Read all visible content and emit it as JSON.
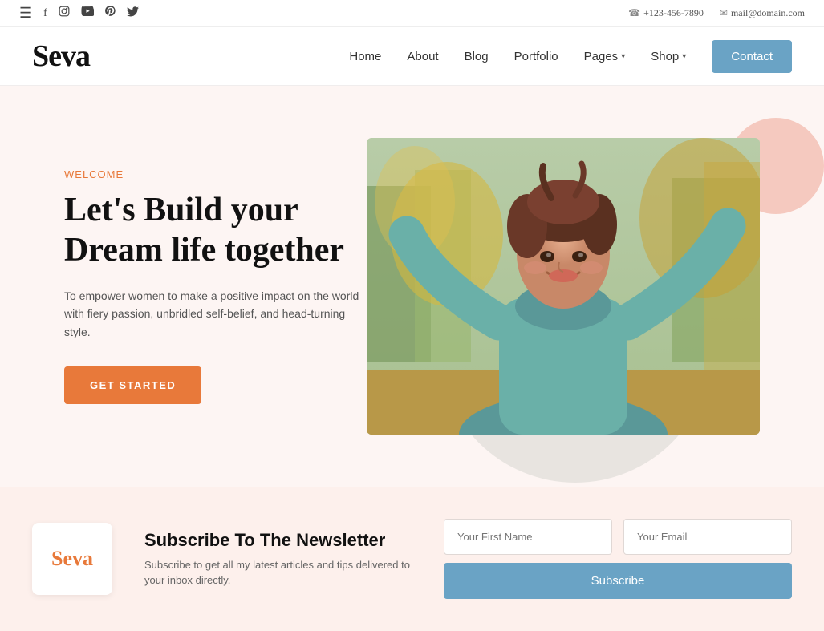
{
  "topbar": {
    "phone": "+123-456-7890",
    "email": "mail@domain.com",
    "phone_icon": "☎",
    "email_icon": "✉"
  },
  "header": {
    "logo": "Seva",
    "nav": {
      "home": "Home",
      "about": "About",
      "blog": "Blog",
      "portfolio": "Portfolio",
      "pages": "Pages",
      "shop": "Shop",
      "contact": "Contact"
    }
  },
  "hero": {
    "welcome_label": "Welcome",
    "title_line1": "Let's Build your",
    "title_line2": "Dream life together",
    "description": "To empower women to make a positive impact on the world with fiery passion, unbridled self-belief, and head-turning style.",
    "cta_button": "GET STARTED"
  },
  "newsletter": {
    "logo": "Seva",
    "title": "Subscribe To The Newsletter",
    "description": "Subscribe to get all my latest articles and tips delivered to your inbox directly.",
    "first_name_placeholder": "Your First Name",
    "email_placeholder": "Your Email",
    "subscribe_button": "Subscribe"
  },
  "social": {
    "facebook": "f",
    "instagram": "◯",
    "youtube": "▶",
    "pinterest": "p",
    "twitter": "t"
  }
}
